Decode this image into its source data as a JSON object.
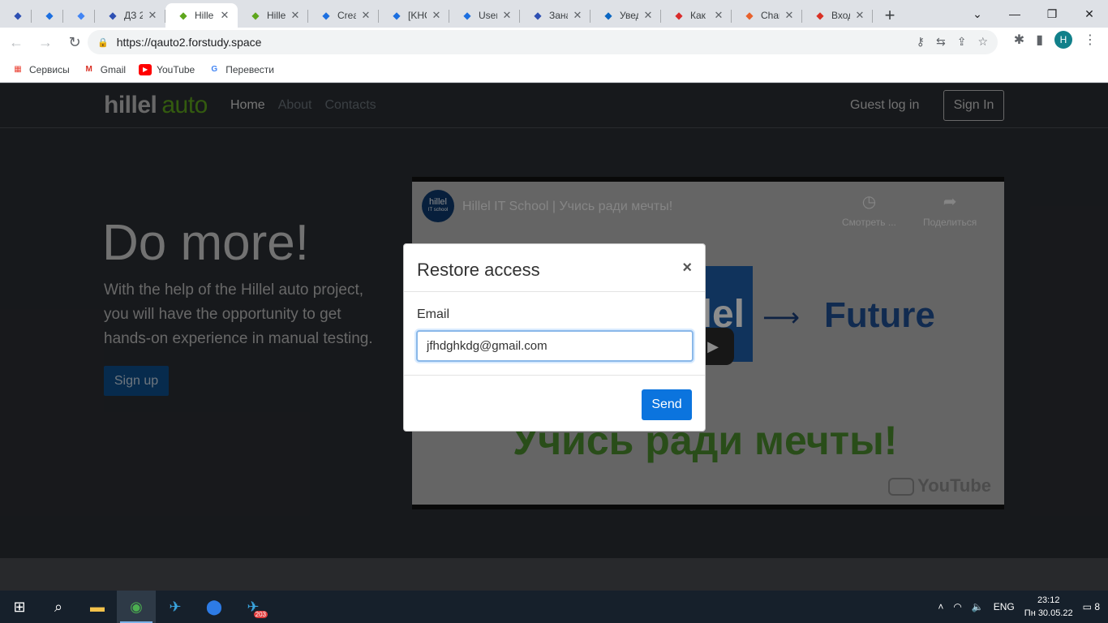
{
  "browser": {
    "tabs": [
      {
        "label": "",
        "icon": "hillel-icon",
        "color": "#2d4fb3"
      },
      {
        "label": "",
        "icon": "jira-icon",
        "color": "#1c6fe0"
      },
      {
        "label": "",
        "icon": "google-icon",
        "color": "#4285f4"
      },
      {
        "label": "ДЗ 2",
        "icon": "hillel-icon",
        "color": "#2d4fb3"
      },
      {
        "label": "Hille",
        "icon": "hillel-auto-icon",
        "color": "#5ea61c",
        "active": true
      },
      {
        "label": "Hille",
        "icon": "hillel-auto-icon",
        "color": "#5ea61c"
      },
      {
        "label": "Crea",
        "icon": "jira-icon",
        "color": "#1c6fe0"
      },
      {
        "label": "[KHC",
        "icon": "jira-icon",
        "color": "#1c6fe0"
      },
      {
        "label": "User",
        "icon": "confluence-icon",
        "color": "#1c6fe0"
      },
      {
        "label": "Зана",
        "icon": "hillel-icon",
        "color": "#2d4fb3"
      },
      {
        "label": "Увед",
        "icon": "linkedin-icon",
        "color": "#0a66c2"
      },
      {
        "label": "Как",
        "icon": "yandex-icon",
        "color": "#d92b2b"
      },
      {
        "label": "Char",
        "icon": "chat-icon",
        "color": "#e8612c"
      },
      {
        "label": "Вход",
        "icon": "gmail-icon",
        "color": "#d93025"
      }
    ],
    "url": "https://qauto2.forstudy.space",
    "profile_initial": "H",
    "bookmarks": [
      {
        "label": "Сервисы",
        "icon": "apps-grid-icon"
      },
      {
        "label": "Gmail",
        "icon": "gmail-icon"
      },
      {
        "label": "YouTube",
        "icon": "youtube-icon"
      },
      {
        "label": "Перевести",
        "icon": "translate-icon"
      }
    ]
  },
  "site": {
    "logo_part1": "hillel",
    "logo_part2": "auto",
    "nav": [
      "Home",
      "About",
      "Contacts"
    ],
    "guest_login": "Guest log in",
    "sign_in": "Sign In",
    "hero_title": "Do more!",
    "hero_text": "With the help of the Hillel auto project, you will have the opportunity to get hands-on experience in manual testing.",
    "sign_up": "Sign up",
    "video": {
      "channel_logo": "hillel",
      "channel_logo_sub": "IT school",
      "title": "Hillel IT School | Учись ради мечты!",
      "watch_later": "Смотреть ...",
      "share": "Поделиться",
      "panel_text": "lel",
      "future_text": "Future",
      "subtitle": "Учись ради мечты!",
      "youtube_brand": "YouTube"
    }
  },
  "modal": {
    "title": "Restore access",
    "email_label": "Email",
    "email_value": "jfhdghkdg@gmail.com",
    "send": "Send"
  },
  "taskbar": {
    "language": "ENG",
    "time": "23:12",
    "date": "Пн 30.05.22",
    "notifications": "8",
    "telegram_badge": "203"
  }
}
